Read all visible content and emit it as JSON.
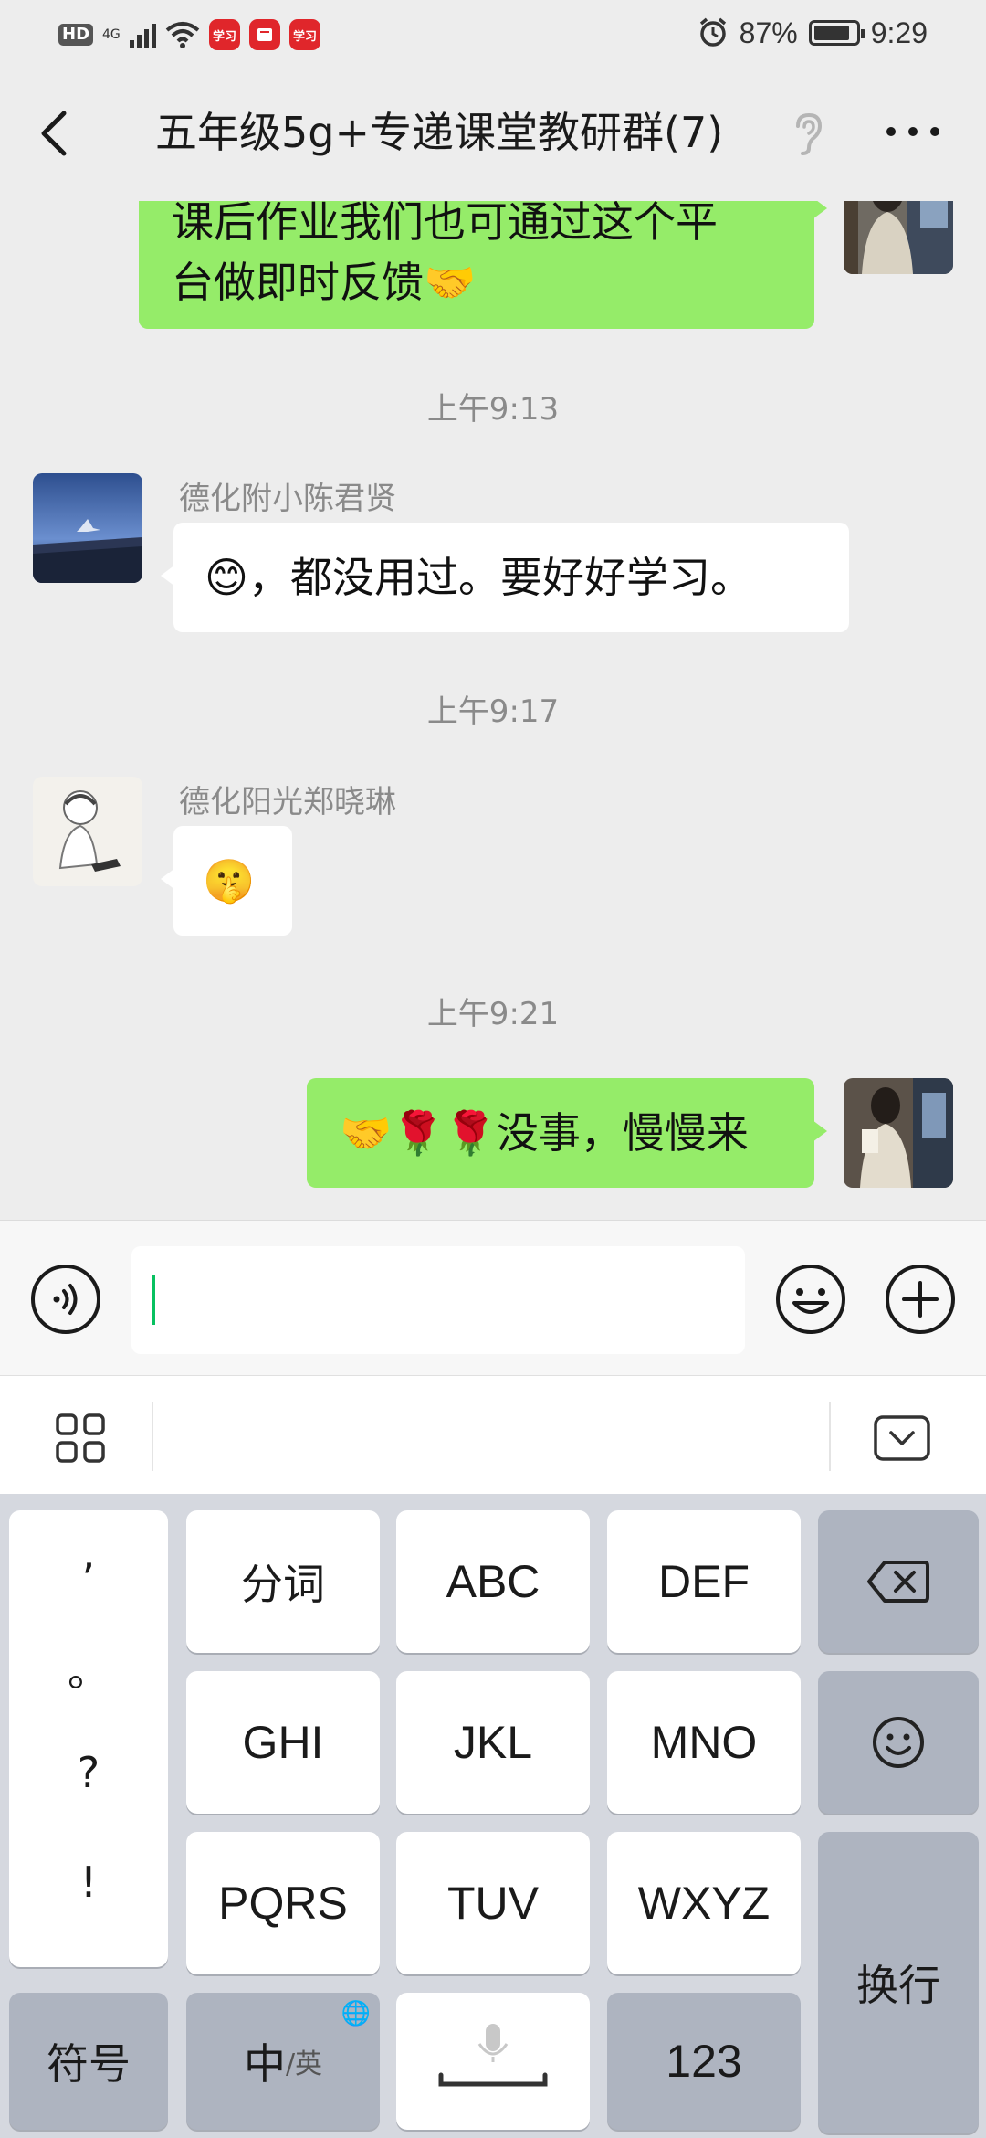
{
  "status_bar": {
    "hd": "HD",
    "network": "4G",
    "battery_level": 0.87,
    "battery_text": "87%",
    "time": "9:29",
    "app_badge_1": "学习",
    "app_badge_3": "学习"
  },
  "header": {
    "title": "五年级5g+专递课堂教研群(7)"
  },
  "messages": [
    {
      "type": "outgoing",
      "lines": [
        "课后作业我们也可通过这个平",
        "台做即时反馈🤝"
      ]
    },
    {
      "type": "timestamp",
      "text": "上午9:13"
    },
    {
      "type": "incoming",
      "sender": "德化附小陈君贤",
      "text": "😊，都没用过。要好好学习。"
    },
    {
      "type": "timestamp",
      "text": "上午9:17"
    },
    {
      "type": "incoming",
      "sender": "德化阳光郑晓琳",
      "text": "🤫"
    },
    {
      "type": "timestamp",
      "text": "上午9:21"
    },
    {
      "type": "outgoing",
      "text": "🤝🌹🌹没事，慢慢来"
    }
  ],
  "input": {
    "value": "",
    "placeholder": ""
  },
  "keyboard": {
    "punct": [
      ",",
      "。",
      "?",
      "!"
    ],
    "row1": [
      "分词",
      "ABC",
      "DEF"
    ],
    "row2": [
      "GHI",
      "JKL",
      "MNO"
    ],
    "row3": [
      "PQRS",
      "TUV",
      "WXYZ"
    ],
    "symbols": "符号",
    "lang_main": "中",
    "lang_sub": "/英",
    "numbers": "123",
    "enter": "换行"
  },
  "colors": {
    "outgoing_bubble": "#95ec69",
    "incoming_bubble": "#ffffff",
    "chat_bg": "#ededed",
    "cursor": "#07c160"
  }
}
